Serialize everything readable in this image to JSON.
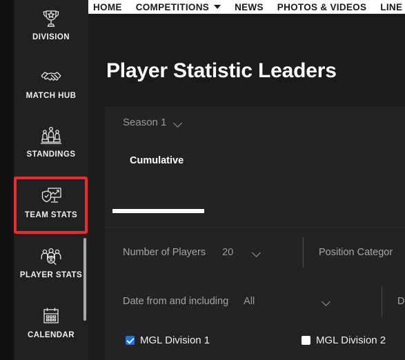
{
  "sidebar": {
    "items": [
      {
        "label": "DIVISION",
        "icon": "trophy-icon"
      },
      {
        "label": "MATCH HUB",
        "icon": "handshake-icon"
      },
      {
        "label": "STANDINGS",
        "icon": "podium-people-icon"
      },
      {
        "label": "TEAM STATS",
        "icon": "shield-chart-icon"
      },
      {
        "label": "PLAYER STATS",
        "icon": "people-search-icon"
      },
      {
        "label": "CALENDAR",
        "icon": "calendar-icon"
      }
    ],
    "highlighted_item": "TEAM STATS",
    "highlight_color": "#ef2a2a"
  },
  "topnav": {
    "items": [
      {
        "label": "HOME",
        "has_caret": false
      },
      {
        "label": "COMPETITIONS",
        "has_caret": true
      },
      {
        "label": "NEWS",
        "has_caret": false
      },
      {
        "label": "PHOTOS & VIDEOS",
        "has_caret": false
      },
      {
        "label": "LINE",
        "has_caret": false
      }
    ]
  },
  "main": {
    "page_title": "Player Statistic Leaders",
    "season_selector": {
      "value": "Season 1"
    },
    "tabs": [
      {
        "label": "Cumulative",
        "active": true
      }
    ],
    "filters": {
      "row1": [
        {
          "label": "Number of Players",
          "value": "20"
        },
        {
          "label": "Position Categor",
          "value": ""
        }
      ],
      "row2": [
        {
          "label": "Date from and including",
          "value": "All"
        },
        {
          "label": "D",
          "value": ""
        }
      ]
    },
    "divisions": [
      {
        "label": "MGL Division 1",
        "checked": true
      },
      {
        "label": "MGL Division 2",
        "checked": false
      }
    ]
  },
  "colors": {
    "page_bg": "#1b1b1b",
    "sidebar_bg": "#212121",
    "card_bg": "#232323",
    "accent_red": "#ef2a2a",
    "checkbox_blue": "#1a73e8",
    "topnav_bg": "#ffffff"
  }
}
